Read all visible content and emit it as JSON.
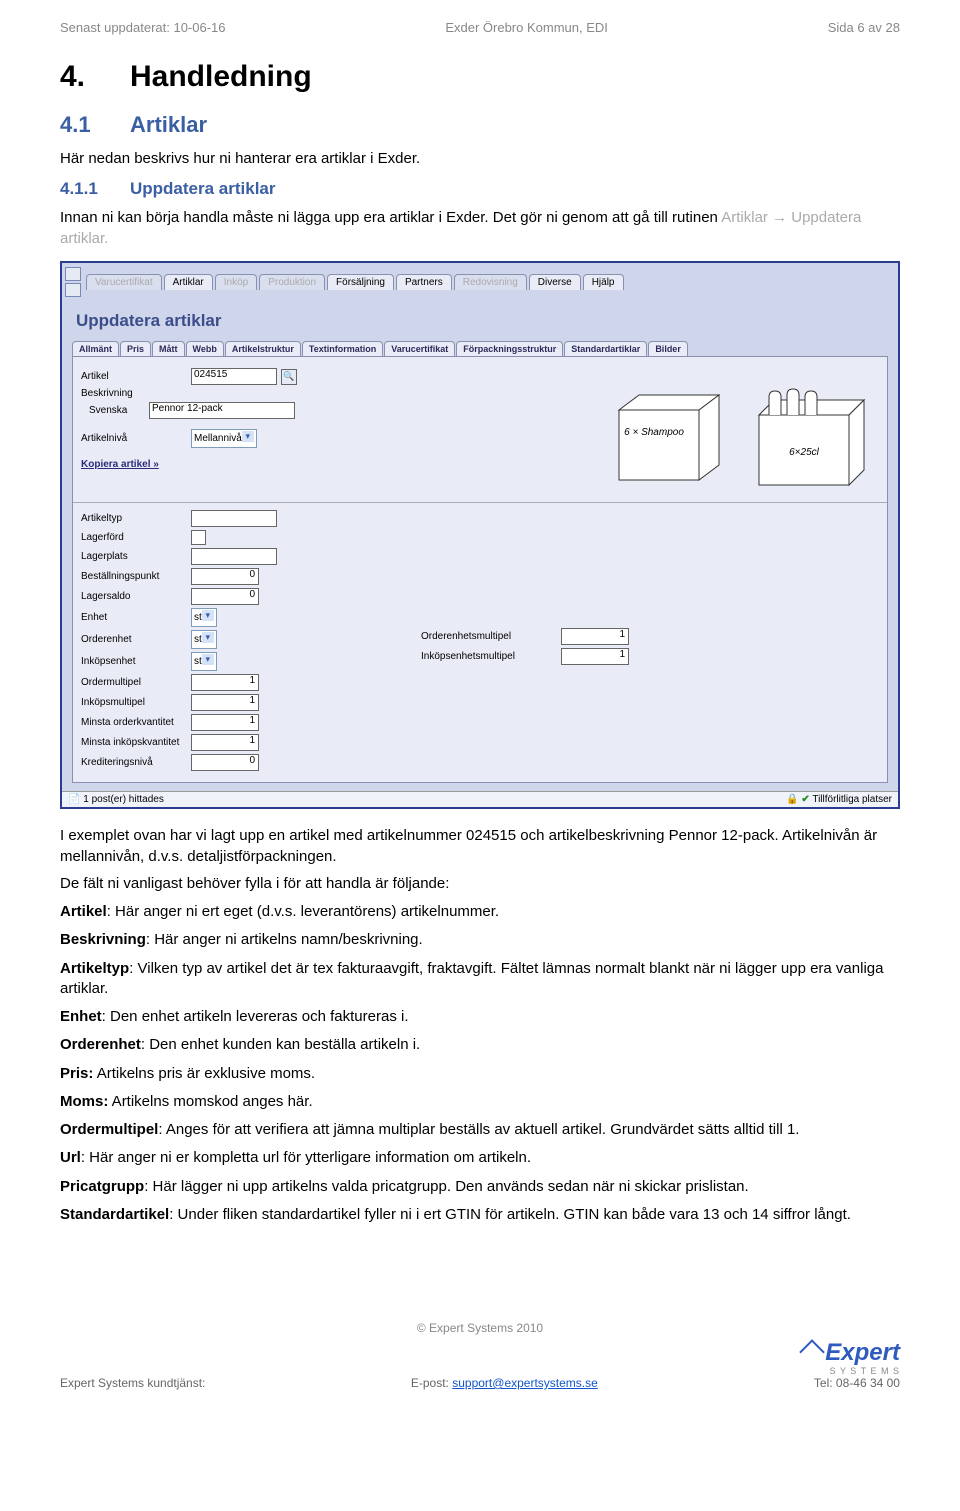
{
  "header": {
    "left": "Senast uppdaterat: 10-06-16",
    "center": "Exder Örebro Kommun, EDI",
    "right": "Sida 6 av 28"
  },
  "h1": {
    "num": "4.",
    "title": "Handledning"
  },
  "h2": {
    "num": "4.1",
    "title": "Artiklar"
  },
  "intro1": "Här nedan beskrivs hur ni hanterar era artiklar i Exder.",
  "h3": {
    "num": "4.1.1",
    "title": "Uppdatera artiklar"
  },
  "intro2a": "Innan ni kan börja handla måste ni lägga upp era artiklar i Exder. Det gör ni genom att gå till rutinen ",
  "intro2b": "Artiklar → Uppdatera artiklar.",
  "app": {
    "menus": {
      "m1": "Varucertifikat",
      "m2": "Artiklar",
      "m3": "Inköp",
      "m4": "Produktion",
      "m5": "Försäljning",
      "m6": "Partners",
      "m7": "Redovisning",
      "m8": "Diverse",
      "m9": "Hjälp"
    },
    "title": "Uppdatera artiklar",
    "subtabs": {
      "t1": "Allmänt",
      "t2": "Pris",
      "t3": "Mått",
      "t4": "Webb",
      "t5": "Artikelstruktur",
      "t6": "Textinformation",
      "t7": "Varucertifikat",
      "t8": "Förpackningsstruktur",
      "t9": "Standardartiklar",
      "t10": "Bilder"
    },
    "labels": {
      "artikel": "Artikel",
      "beskrivning": "Beskrivning",
      "svenska": "Svenska",
      "artikelniva": "Artikelnivå",
      "kopiera": "Kopiera artikel »",
      "artikeltyp": "Artikeltyp",
      "lagerford": "Lagerförd",
      "lagerplats": "Lagerplats",
      "bestpunkt": "Beställningspunkt",
      "lagersaldo": "Lagersaldo",
      "enhet": "Enhet",
      "orderenhet": "Orderenhet",
      "inkopsenhet": "Inköpsenhet",
      "ordermultipel": "Ordermultipel",
      "inkopsmultipel": "Inköpsmultipel",
      "minorder": "Minsta orderkvantitet",
      "mininkop": "Minsta inköpskvantitet",
      "kreditniva": "Krediteringsnivå",
      "orderenhetsmul": "Orderenhetsmultipel",
      "inkopsenhetsmul": "Inköpsenhetsmultipel"
    },
    "values": {
      "artikel": "024515",
      "beskrivning": "Pennor 12-pack",
      "artikelniva": "Mellannivå",
      "bestpunkt": "0",
      "lagersaldo": "0",
      "enhet": "st",
      "orderenhet": "st",
      "inkopsenhet": "st",
      "ordermultipel": "1",
      "inkopsmultipel": "1",
      "minorder": "1",
      "mininkop": "1",
      "kreditniva": "0",
      "orderenhetsmul": "1",
      "inkopsenhetsmul": "1"
    },
    "status": {
      "left": "1 post(er) hittades",
      "right": "Tillförlitliga platser"
    },
    "illus": {
      "box": "6 × Shampoo",
      "bottles": "6×25cl"
    }
  },
  "body_after": "I exemplet ovan har vi lagt upp en artikel med artikelnummer 024515 och artikelbeskrivning Pennor 12-pack. Artikelnivån är mellannivån, d.v.s. detaljistförpackningen.",
  "body_after2": "De fält ni vanligast behöver fylla i för att handla är följande:",
  "glossary": {
    "artikel_l": "Artikel",
    "artikel_t": ": Här anger ni ert eget (d.v.s. leverantörens) artikelnummer.",
    "beskr_l": "Beskrivning",
    "beskr_t": ": Här anger ni artikelns namn/beskrivning.",
    "atyp_l": "Artikeltyp",
    "atyp_t": ": Vilken typ av artikel det är tex fakturaavgift, fraktavgift. Fältet lämnas normalt blankt när ni lägger upp era vanliga artiklar.",
    "enhet_l": "Enhet",
    "enhet_t": ": Den enhet artikeln levereras och faktureras i.",
    "oenhet_l": "Orderenhet",
    "oenhet_t": ": Den enhet kunden kan beställa artikeln i.",
    "pris_l": "Pris:",
    "pris_t": " Artikelns pris är exklusive moms.",
    "moms_l": "Moms:",
    "moms_t": " Artikelns momskod anges här.",
    "omul_l": "Ordermultipel",
    "omul_t": ": Anges för att verifiera att jämna multiplar beställs av aktuell artikel. Grundvärdet sätts alltid till 1.",
    "url_l": "Url",
    "url_t": ": Här anger ni er kompletta url för ytterligare information om artikeln.",
    "pcat_l": "Pricatgrupp",
    "pcat_t": ": Här lägger ni upp artikelns valda pricatgrupp. Den används sedan när ni skickar prislistan.",
    "std_l": "Standardartikel",
    "std_t": ": Under fliken standardartikel fyller ni i ert GTIN för artikeln. GTIN kan både vara 13 och 14 siffror långt."
  },
  "footer": {
    "copyright": "© Expert Systems 2010",
    "left": "Expert Systems kundtjänst:",
    "mid_pre": "E-post: ",
    "mid_link": "support@expertsystems.se",
    "right": "Tel: 08-46 34 00",
    "logo": "Expert",
    "logo_sub": "S Y S T E M S"
  }
}
